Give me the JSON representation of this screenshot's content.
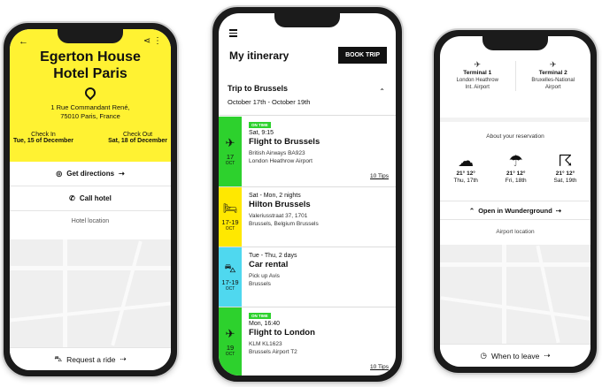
{
  "phone1": {
    "back_icon": "arrow-left-icon",
    "share_icon": "share-icon",
    "hotel_name_1": "Egerton House",
    "hotel_name_2": "Hotel Paris",
    "address_1": "1 Rue Commandant René,",
    "address_2": "75010 Paris, France",
    "checkin_label": "Check In",
    "checkin_date": "Tue, 15 of December",
    "checkout_label": "Check Out",
    "checkout_date": "Sat, 18 of December",
    "directions_label": "Get directions",
    "call_label": "Call hotel",
    "location_label": "Hotel location",
    "ride_label": "Request a ride",
    "accent": "#fff232"
  },
  "phone2": {
    "title": "My itinerary",
    "book_label": "BOOK TRIP",
    "trip_title": "Trip to Brussels",
    "trip_dates": "October 17th - October 19th",
    "cards": [
      {
        "color": "#2dd12d",
        "icon": "plane-icon",
        "day": "17",
        "month": "OCT",
        "tag": "ON TIME",
        "line1": "Sat, 9:15",
        "title": "Flight to Brussels",
        "sub1": "British Airways BA923",
        "sub2": "London Heathrow Airport",
        "tips": "10 Tips"
      },
      {
        "color": "#ffe800",
        "icon": "bed-icon",
        "day": "17-19",
        "month": "OCT",
        "tag": "",
        "line1": "Sat - Mon, 2 nights",
        "title": "Hilton Brussels",
        "sub1": "Valeriusstraat 37, 1701",
        "sub2": "Brussels, Belgium Brussels",
        "tips": ""
      },
      {
        "color": "#4fd8ef",
        "icon": "car-icon",
        "day": "17-19",
        "month": "OCT",
        "tag": "",
        "line1": "Tue - Thu, 2 days",
        "title": "Car rental",
        "sub1": "Pick up Avis",
        "sub2": "Brussels",
        "tips": ""
      },
      {
        "color": "#2dd12d",
        "icon": "plane-icon",
        "day": "19",
        "month": "OCT",
        "tag": "ON TIME",
        "line1": "Mon, 16:40",
        "title": "Flight to London",
        "sub1": "KLM KL1623",
        "sub2": "Brussels Airport T2",
        "tips": "10 Tips"
      }
    ]
  },
  "phone3": {
    "terminal1": "Terminal 1",
    "terminal1_sub1": "London Heathrow",
    "terminal1_sub2": "Int. Airport",
    "terminal2": "Terminal 2",
    "terminal2_sub1": "Bruxelles-National",
    "terminal2_sub2": "Airport",
    "about_label": "About your reservation",
    "weather": [
      {
        "icon": "cloud-icon",
        "temps": "21° 12°",
        "day": "Thu, 17th"
      },
      {
        "icon": "rain-icon",
        "temps": "21° 12°",
        "day": "Fri, 18th"
      },
      {
        "icon": "storm-icon",
        "temps": "21° 12°",
        "day": "Sat, 19th"
      }
    ],
    "wunder_label": "Open in Wunderground",
    "airport_label": "Airport location",
    "leave_label": "When to leave"
  }
}
